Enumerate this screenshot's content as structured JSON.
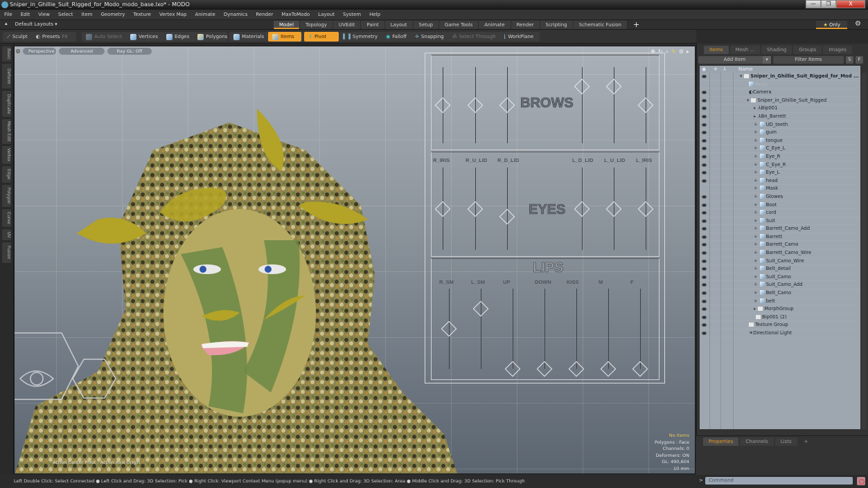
{
  "window": {
    "title": "Sniper_in_Ghillie_Suit_Rigged_for_Modo_modo_base.lxo* - MODO",
    "min": "—",
    "max": "❐",
    "close": "X"
  },
  "menu": [
    "File",
    "Edit",
    "View",
    "Select",
    "Item",
    "Geometry",
    "Texture",
    "Vertex Map",
    "Animate",
    "Dynamics",
    "Render",
    "MaxToModo",
    "Layout",
    "System",
    "Help"
  ],
  "layoutbar": {
    "layouts_label": "Default Layouts ▾",
    "tabs": [
      "Model",
      "Topology",
      "UVEdit",
      "Paint",
      "Layout",
      "Setup",
      "Game Tools",
      "Animate",
      "Render",
      "Scripting",
      "Schematic Fusion"
    ],
    "active_tab": "Model",
    "add": "+",
    "only": "Only",
    "only_star": "★"
  },
  "toolbar": {
    "sculpt": "Sculpt",
    "presets": "Presets",
    "presets_key": "F6",
    "auto_select": "Auto Select",
    "vertices": "Vertices",
    "edges": "Edges",
    "polygons": "Polygons",
    "materials": "Materials",
    "items": "Items",
    "pivot": "Pivot",
    "symmetry": "Symmetry",
    "falloff": "Falloff",
    "snapping": "Snapping",
    "select_through": "Select Through",
    "workplane": "WorkPlane"
  },
  "sidebar_tabs": [
    "Basic",
    "Deform",
    "Duplicate",
    "Mesh Edit",
    "Vertex",
    "Edge",
    "Polygon",
    "Curve",
    "UV",
    "Fusion"
  ],
  "viewport": {
    "view": "Perspective",
    "shading": "Advanced",
    "raygl": "Ray GL: Off",
    "action_center": "Action Center Pivot : Action Axis Origin",
    "info": {
      "selection": "No Items",
      "polygons": "Polygons : Face",
      "channels": "Channels: 0",
      "deformers": "Deformers: ON",
      "gl": "GL: 490,604",
      "unit": "10 mm"
    },
    "face_gui": {
      "brows_title": "BROWS",
      "eyes_title": "EYES",
      "lips_title": "LIPS",
      "eye_labels": [
        "R_IRIS",
        "R_U_LID",
        "R_D_LID",
        "L_D_LID",
        "L_U_LID",
        "L_IRIS"
      ],
      "lip_labels": [
        "R_SM",
        "L_SM",
        "UP",
        "DOWN",
        "KISS",
        "M",
        "F"
      ],
      "brows_values": [
        0.5,
        0.5,
        0.5,
        0.75,
        0.75,
        0.5
      ],
      "eyes_values": [
        0.5,
        0.5,
        0.4,
        0.5,
        0.5,
        0.5
      ],
      "lips_values": [
        0.5,
        0.75,
        0,
        0,
        0,
        0,
        0
      ]
    }
  },
  "statusbar": "Left Double Click: Select Connected ● Left Click and Drag: 3D Selection: Pick ● Right Click: Viewport Context Menu (popup menu) ● Right Click and Drag: 3D Selection: Area ● Middle Click and Drag: 3D Selection: Pick Through",
  "items_panel": {
    "tabs": [
      "Items",
      "Mesh ...",
      "Shading",
      "Groups",
      "Images"
    ],
    "active": "Items",
    "add_item": "Add Item",
    "filter": "Filter Items",
    "s": "S",
    "f": "F",
    "name_header": "Name",
    "rows": [
      {
        "label": "Sniper_in_Ghillie_Suit_Rigged_for_Mod ...",
        "depth": 0,
        "icon": "scene",
        "exp": "▾",
        "eye": true,
        "bold": true
      },
      {
        "label": "Mesh",
        "depth": 1,
        "icon": "mesh",
        "exp": "",
        "eye": false,
        "dim": true
      },
      {
        "label": "Camera",
        "depth": 1,
        "icon": "camera",
        "exp": "",
        "eye": true
      },
      {
        "label": "Sniper_in_Ghillie_Suit_Rigged",
        "depth": 1,
        "icon": "folder",
        "exp": "▾",
        "eye": true
      },
      {
        "label": "Bip001",
        "depth": 2,
        "icon": "bone",
        "exp": "▸",
        "eye": true
      },
      {
        "label": "Bn_Barrett",
        "depth": 2,
        "icon": "bone",
        "exp": "▸",
        "eye": true
      },
      {
        "label": "UD_teeth",
        "depth": 2,
        "icon": "mesh",
        "exp": "+",
        "eye": true
      },
      {
        "label": "gum",
        "depth": 2,
        "icon": "mesh",
        "exp": "+",
        "eye": true
      },
      {
        "label": "tongue",
        "depth": 2,
        "icon": "mesh",
        "exp": "+",
        "eye": true
      },
      {
        "label": "C_Eye_L",
        "depth": 2,
        "icon": "mesh",
        "exp": "+",
        "eye": true
      },
      {
        "label": "Eye_R",
        "depth": 2,
        "icon": "mesh",
        "exp": "+",
        "eye": true
      },
      {
        "label": "C_Eye_R",
        "depth": 2,
        "icon": "mesh",
        "exp": "+",
        "eye": true
      },
      {
        "label": "Eye_L",
        "depth": 2,
        "icon": "mesh",
        "exp": "+",
        "eye": true
      },
      {
        "label": "head",
        "depth": 2,
        "icon": "mesh",
        "exp": "+",
        "eye": true
      },
      {
        "label": "Mask",
        "depth": 2,
        "icon": "mesh",
        "exp": "+",
        "eye": false
      },
      {
        "label": "Glowes",
        "depth": 2,
        "icon": "mesh",
        "exp": "+",
        "eye": true
      },
      {
        "label": "Boot",
        "depth": 2,
        "icon": "mesh",
        "exp": "+",
        "eye": true
      },
      {
        "label": "cord",
        "depth": 2,
        "icon": "mesh",
        "exp": "+",
        "eye": true
      },
      {
        "label": "Suit",
        "depth": 2,
        "icon": "mesh",
        "exp": "+",
        "eye": true
      },
      {
        "label": "Barrett_Camo_Add",
        "depth": 2,
        "icon": "mesh",
        "exp": "+",
        "eye": true
      },
      {
        "label": "Barrett",
        "depth": 2,
        "icon": "mesh",
        "exp": "+",
        "eye": true
      },
      {
        "label": "Barrett_Camo",
        "depth": 2,
        "icon": "mesh",
        "exp": "+",
        "eye": true
      },
      {
        "label": "Barrett_Camo_Wire",
        "depth": 2,
        "icon": "mesh",
        "exp": "+",
        "eye": true
      },
      {
        "label": "Suit_Camo_Wire",
        "depth": 2,
        "icon": "mesh",
        "exp": "+",
        "eye": true
      },
      {
        "label": "Belt_detail",
        "depth": 2,
        "icon": "mesh",
        "exp": "+",
        "eye": true
      },
      {
        "label": "Suit_Camo",
        "depth": 2,
        "icon": "mesh",
        "exp": "+",
        "eye": true
      },
      {
        "label": "Suit_Camo_Add",
        "depth": 2,
        "icon": "mesh",
        "exp": "+",
        "eye": true
      },
      {
        "label": "Belt_Camo",
        "depth": 2,
        "icon": "mesh",
        "exp": "+",
        "eye": true
      },
      {
        "label": "belt",
        "depth": 2,
        "icon": "mesh",
        "exp": "+",
        "eye": true
      },
      {
        "label": "MorphGroup",
        "depth": 2,
        "icon": "folder",
        "exp": "▸",
        "eye": true
      },
      {
        "label": "Bip001 (2)",
        "depth": 2,
        "icon": "folder",
        "exp": "",
        "eye": true
      },
      {
        "label": "Texture Group",
        "depth": 1,
        "icon": "folder",
        "exp": "",
        "eye": true
      },
      {
        "label": "Directional Light",
        "depth": 1,
        "icon": "light",
        "exp": "",
        "eye": true
      }
    ]
  },
  "properties_panel": {
    "tabs": [
      "Properties",
      "Channels",
      "Lists"
    ],
    "active": "Properties",
    "add": "+"
  },
  "command": {
    "placeholder": "Command",
    "prompt": ">"
  },
  "colors": {
    "accent": "#e39a2b",
    "orange_button": "#f0a12c"
  }
}
